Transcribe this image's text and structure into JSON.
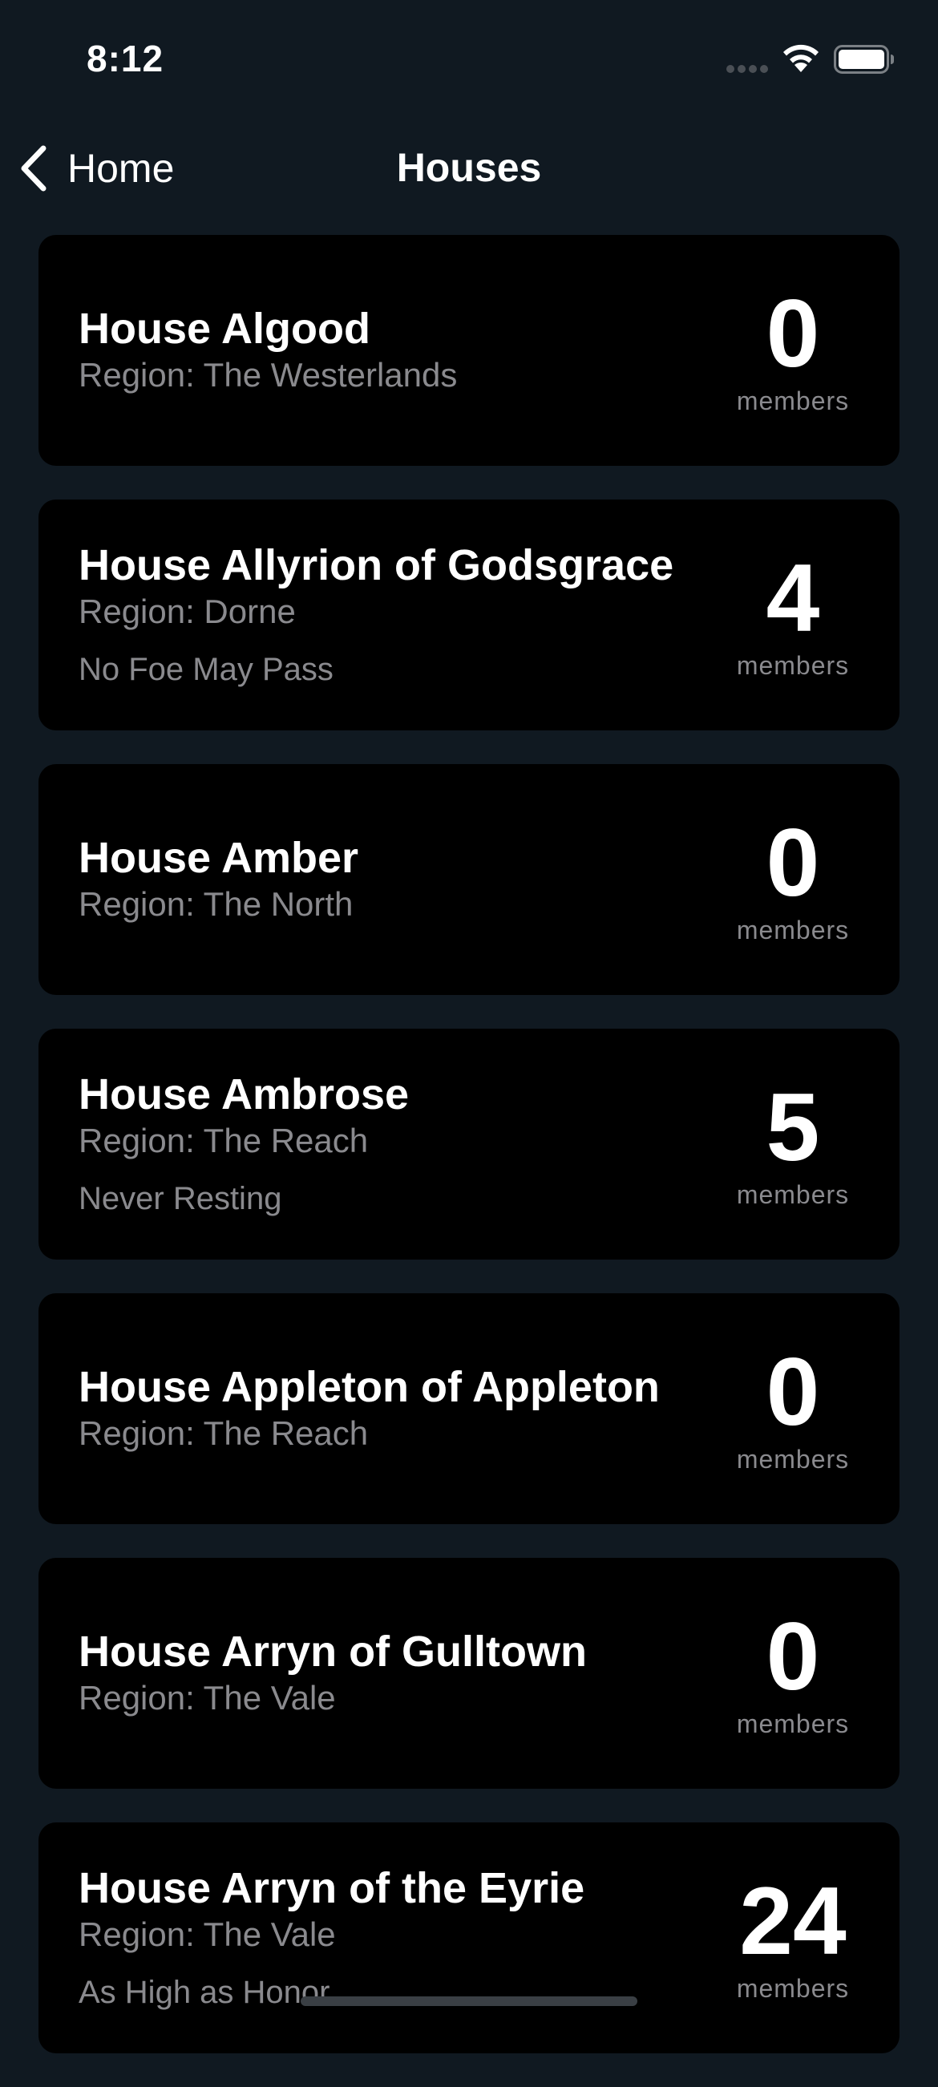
{
  "status_bar": {
    "time": "8:12"
  },
  "nav": {
    "back_label": "Home",
    "title": "Houses"
  },
  "houses": [
    {
      "name": "House Algood",
      "region": "Region: The Westerlands",
      "words": "",
      "count": "0",
      "count_label": "members"
    },
    {
      "name": "House Allyrion of Godsgrace",
      "region": "Region: Dorne",
      "words": "No Foe May Pass",
      "count": "4",
      "count_label": "members"
    },
    {
      "name": "House Amber",
      "region": "Region: The North",
      "words": "",
      "count": "0",
      "count_label": "members"
    },
    {
      "name": "House Ambrose",
      "region": "Region: The Reach",
      "words": "Never Resting",
      "count": "5",
      "count_label": "members"
    },
    {
      "name": "House Appleton of Appleton",
      "region": "Region: The Reach",
      "words": "",
      "count": "0",
      "count_label": "members"
    },
    {
      "name": "House Arryn of Gulltown",
      "region": "Region: The Vale",
      "words": "",
      "count": "0",
      "count_label": "members"
    },
    {
      "name": "House Arryn of the Eyrie",
      "region": "Region: The Vale",
      "words": "As High as Honor",
      "count": "24",
      "count_label": "members"
    }
  ],
  "colors": {
    "background": "#101921",
    "card": "#000000",
    "secondary_text": "#8a8a8e"
  },
  "icons": {
    "back": "chevron-left-icon",
    "signal": "cellular-signal-icon",
    "wifi": "wifi-icon",
    "battery": "battery-icon"
  }
}
